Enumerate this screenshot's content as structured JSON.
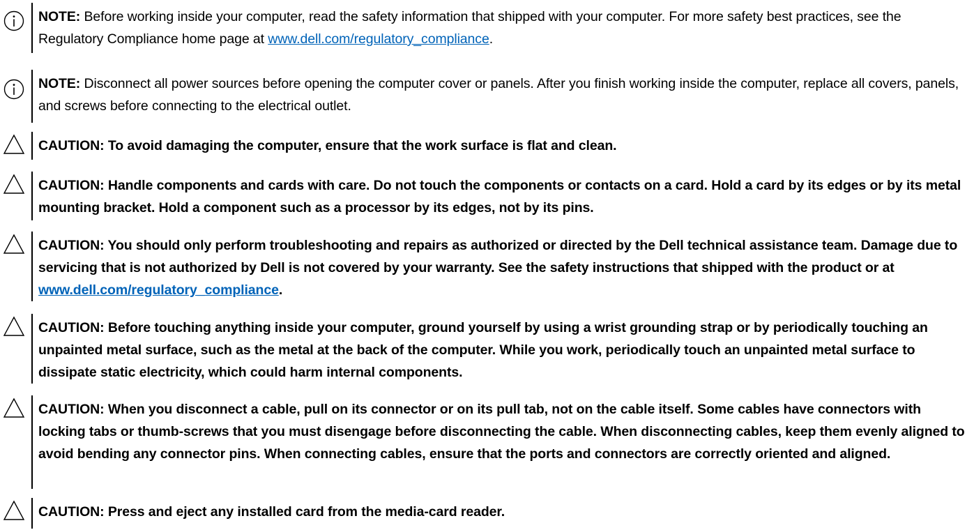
{
  "notices": [
    {
      "type": "note",
      "label": "NOTE:",
      "text_before": " Before working inside your computer, read the safety information that shipped with your computer. For more safety best practices, see the Regulatory Compliance home page at ",
      "link": "www.dell.com/regulatory_compliance",
      "text_after": "."
    },
    {
      "type": "note",
      "label": "NOTE:",
      "text_before": " Disconnect all power sources before opening the computer cover or panels. After you finish working inside the computer, replace all covers, panels, and screws before connecting to the electrical outlet.",
      "link": "",
      "text_after": ""
    },
    {
      "type": "caution",
      "label": "",
      "text_before": "CAUTION: To avoid damaging the computer, ensure that the work surface is flat and clean.",
      "link": "",
      "text_after": ""
    },
    {
      "type": "caution",
      "label": "",
      "text_before": "CAUTION: Handle components and cards with care. Do not touch the components or contacts on a card. Hold a card by its edges or by its metal mounting bracket. Hold a component such as a processor by its edges, not by its pins.",
      "link": "",
      "text_after": ""
    },
    {
      "type": "caution",
      "label": "",
      "text_before": "CAUTION: You should only perform troubleshooting and repairs as authorized or directed by the Dell technical assistance team. Damage due to servicing that is not authorized by Dell is not covered by your warranty. See the safety instructions that shipped with the product or at ",
      "link": "www.dell.com/regulatory_compliance",
      "text_after": "."
    },
    {
      "type": "caution",
      "label": "",
      "text_before": "CAUTION: Before touching anything inside your computer, ground yourself by using a wrist grounding strap or by periodically touching an unpainted metal surface, such as the metal at the back of the computer. While you work, periodically touch an unpainted metal surface to dissipate static electricity, which could harm internal components.",
      "link": "",
      "text_after": ""
    },
    {
      "type": "caution",
      "label": "",
      "text_before": "CAUTION: When you disconnect a cable, pull on its connector or on its pull tab, not on the cable itself. Some cables have connectors with locking tabs or thumb-screws that you must disengage before disconnecting the cable. When disconnecting cables, keep them evenly aligned to avoid bending any connector pins. When connecting cables, ensure that the ports and connectors are correctly oriented and aligned.",
      "link": "",
      "text_after": ""
    },
    {
      "type": "caution",
      "label": "",
      "text_before": "CAUTION: Press and eject any installed card from the media-card reader.",
      "link": "",
      "text_after": ""
    }
  ],
  "colors": {
    "link": "#0063b8",
    "text": "#000000",
    "rule": "#000000"
  },
  "icons": {
    "note": "info-circle-icon",
    "caution": "warning-triangle-icon"
  }
}
